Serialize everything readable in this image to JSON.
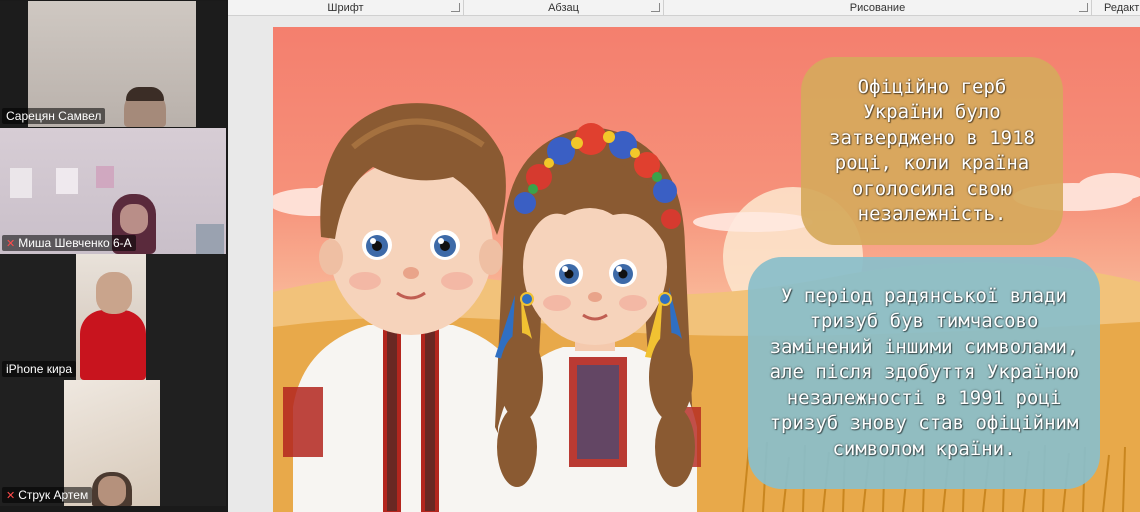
{
  "gallery": {
    "participants": [
      {
        "name": "Сарецян Самвел",
        "muted": false,
        "active": true
      },
      {
        "name": "Миша Шевченко 6-А",
        "muted": true,
        "active": false
      },
      {
        "name": "iPhone кира",
        "muted": false,
        "active": false
      },
      {
        "name": "Струк Артем",
        "muted": true,
        "active": false
      }
    ],
    "active_color": "#23d96e",
    "muted_icon_color": "#ff4b4b"
  },
  "ribbon": {
    "groups": [
      "Шрифт",
      "Абзац",
      "Рисование",
      "Редакт"
    ]
  },
  "slide": {
    "box1_text": "Офіційно герб України було затверджено в 1918 році, коли країна оголосила свою незалежність.",
    "box2_text": "У період радянської влади тризуб був тимчасово замінений іншими символами, але після здобуття Україною незалежності  в 1991 році тризуб знову став офіційним символом країни.",
    "box1_color": "#d6a95c",
    "box2_color": "#8abeca",
    "background_color": "#f47f6e"
  }
}
